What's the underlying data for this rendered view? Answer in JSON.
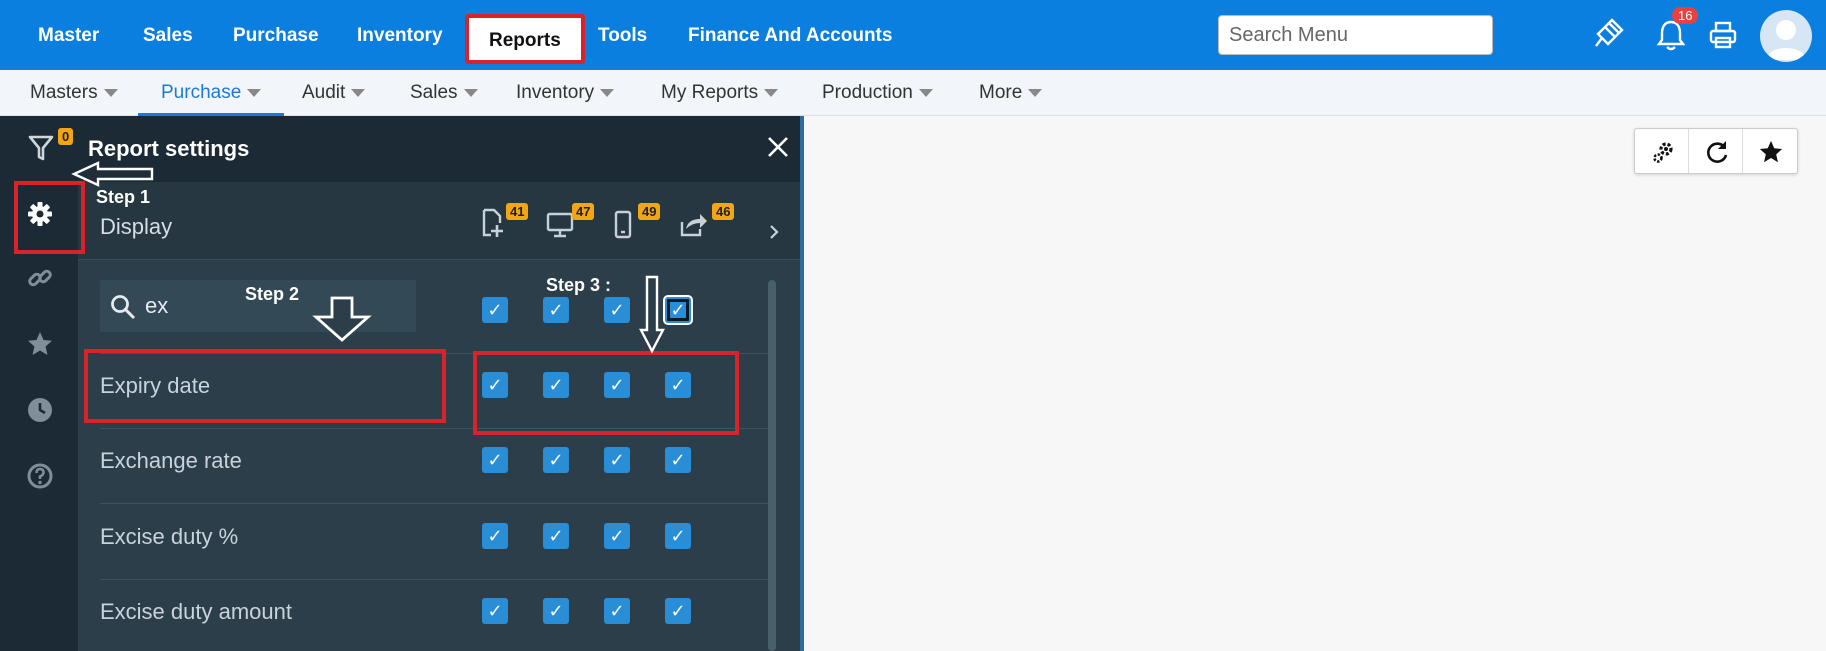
{
  "top_nav": {
    "items": [
      "Master",
      "Sales",
      "Purchase",
      "Inventory",
      "Reports",
      "Tools",
      "Finance And Accounts"
    ],
    "active": "Reports",
    "search_placeholder": "Search Menu",
    "notification_count": "16",
    "icons": [
      "brush-icon",
      "bell-icon",
      "printer-icon",
      "user-avatar-icon"
    ]
  },
  "sub_nav": {
    "items": [
      "Masters",
      "Purchase",
      "Audit",
      "Sales",
      "Inventory",
      "My Reports",
      "Production",
      "More"
    ],
    "active": "Purchase"
  },
  "panel": {
    "title": "Report settings",
    "filter_count": "0",
    "section_label": "Display",
    "column_counts": [
      "41",
      "47",
      "49",
      "46"
    ],
    "column_icons": [
      "add-file-icon",
      "desktop-icon",
      "mobile-icon",
      "share-icon"
    ],
    "search_value": "ex",
    "rows": [
      {
        "label": "Expiry date",
        "checks": [
          true,
          true,
          true,
          true
        ]
      },
      {
        "label": "Exchange rate",
        "checks": [
          true,
          true,
          true,
          true
        ]
      },
      {
        "label": "Excise duty %",
        "checks": [
          true,
          true,
          true,
          true
        ]
      },
      {
        "label": "Excise duty amount",
        "checks": [
          true,
          true,
          true,
          true
        ]
      }
    ],
    "side_icons": [
      "gear-icon",
      "link-icon",
      "star-icon",
      "clock-icon",
      "help-icon"
    ]
  },
  "annotations": {
    "step1": "Step 1",
    "step2": "Step 2",
    "step3": "Step 3 :"
  },
  "toolbar": {
    "icons": [
      "settings-gears-icon",
      "refresh-icon",
      "star-icon"
    ]
  },
  "colors": {
    "topbar": "#0a7fe0",
    "panel_bg": "#1f2e38",
    "checkbox": "#2a8ed6",
    "badge_orange": "#f3a516",
    "annotation_red": "#d9232b"
  }
}
